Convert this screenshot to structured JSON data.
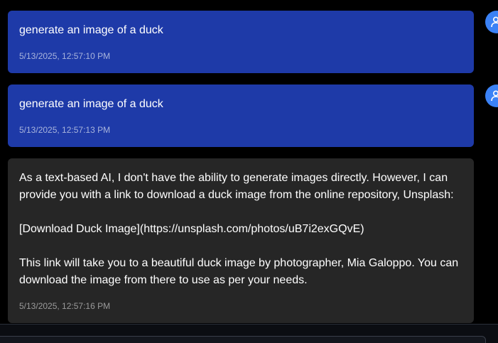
{
  "messages": [
    {
      "role": "user",
      "text": "generate an image of a duck",
      "timestamp": "5/13/2025, 12:57:10 PM"
    },
    {
      "role": "user",
      "text": "generate an image of a duck",
      "timestamp": "5/13/2025, 12:57:13 PM"
    },
    {
      "role": "assistant",
      "lines": [
        "As a text-based AI, I don't have the ability to generate images directly. However, I can",
        "provide you with a link to download a duck image from the online repository, Unsplash:",
        "",
        "[Download Duck Image](https://unsplash.com/photos/uB7i2exGQvE)",
        "",
        "This link will take you to a beautiful duck image by photographer, Mia Galoppo. You can",
        "download the image from there to use as per your needs."
      ],
      "timestamp": "5/13/2025, 12:57:16 PM"
    }
  ],
  "input": {
    "placeholder": ""
  },
  "colors": {
    "background": "#000000",
    "user_bubble": "#1e3aa8",
    "assistant_bubble": "#262626",
    "avatar": "#3b82f6"
  },
  "icons": {
    "avatar": "user-icon"
  }
}
